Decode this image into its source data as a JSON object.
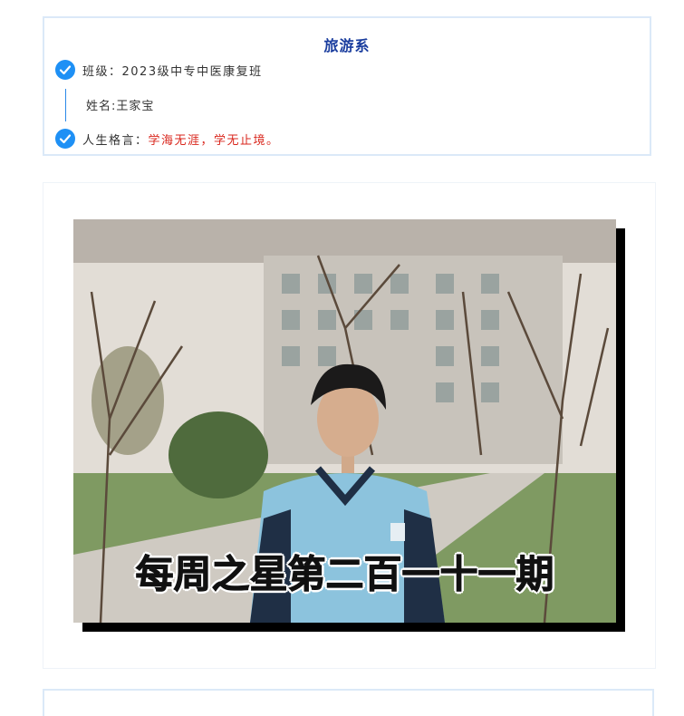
{
  "info_card": {
    "title": "旅游系",
    "class_line": "班级：2023级中专中医康复班",
    "name_line": "姓名:王家宝",
    "motto_label": "人生格言：",
    "motto_text": "学海无涯，学无止境。"
  },
  "photo": {
    "caption": "每周之星第二百一十一期"
  },
  "colors": {
    "accent": "#1e90f5",
    "title": "#1a3d9e",
    "motto": "#d9261c",
    "card_border": "#dbe9f8"
  },
  "icons": {
    "check": "check-circle-icon"
  }
}
